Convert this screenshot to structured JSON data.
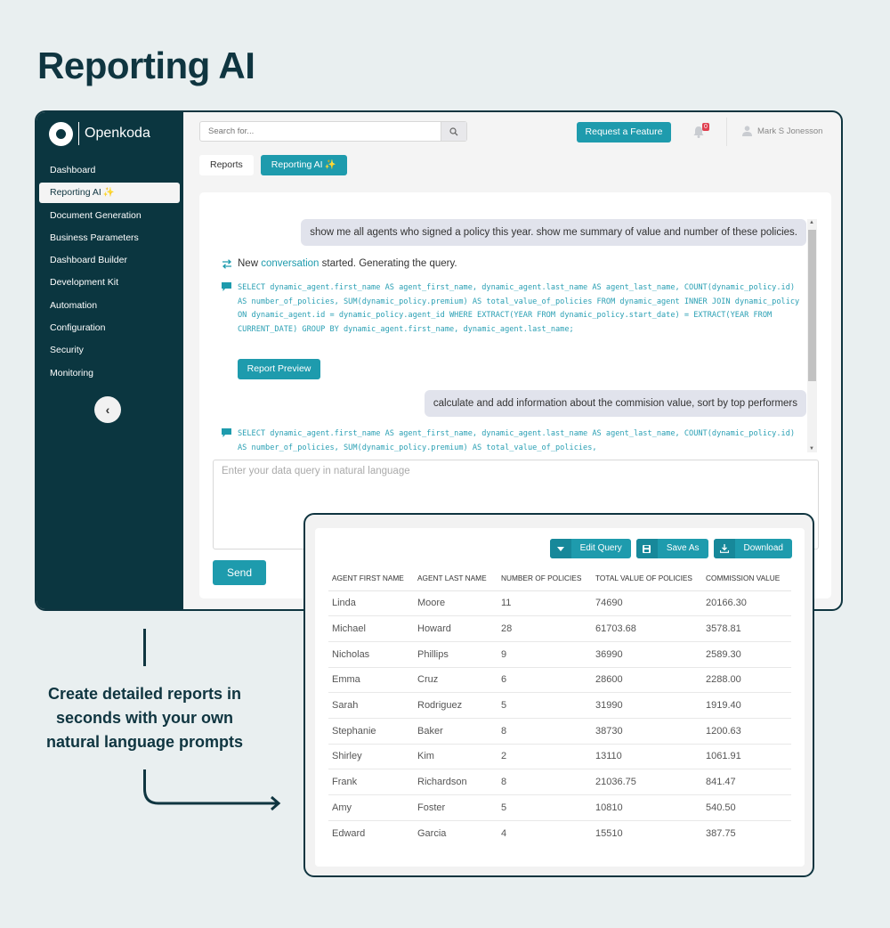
{
  "hero": {
    "title": "Reporting AI",
    "caption": "Create detailed reports in seconds with your own natural language prompts"
  },
  "app": {
    "brand": "Openkoda",
    "sidebar": {
      "items": [
        {
          "label": "Dashboard",
          "active": false
        },
        {
          "label": "Reporting AI",
          "active": true,
          "spark": "✨"
        },
        {
          "label": "Document Generation",
          "active": false
        },
        {
          "label": "Business Parameters",
          "active": false
        },
        {
          "label": "Dashboard Builder",
          "active": false
        },
        {
          "label": "Development Kit",
          "active": false
        },
        {
          "label": "Automation",
          "active": false
        },
        {
          "label": "Configuration",
          "active": false
        },
        {
          "label": "Security",
          "active": false
        },
        {
          "label": "Monitoring",
          "active": false
        }
      ],
      "collapse_icon": "‹"
    },
    "header": {
      "search_placeholder": "Search for...",
      "request_feature_label": "Request a Feature",
      "notifications_count": "0",
      "user_name": "Mark S Jonesson"
    },
    "tabs": [
      {
        "label": "Reports",
        "active": false
      },
      {
        "label": "Reporting AI",
        "active": true,
        "spark": "✨"
      }
    ],
    "chat": {
      "messages": [
        {
          "role": "user",
          "text": "show me all agents who signed a policy this year. show me summary of value and number of these policies."
        },
        {
          "role": "system",
          "prefix": "New",
          "link": "conversation",
          "suffix": "started. Generating the query."
        },
        {
          "role": "sql",
          "text": "SELECT dynamic_agent.first_name AS agent_first_name, dynamic_agent.last_name AS agent_last_name, COUNT(dynamic_policy.id) AS number_of_policies, SUM(dynamic_policy.premium) AS total_value_of_policies FROM dynamic_agent INNER JOIN dynamic_policy ON dynamic_agent.id = dynamic_policy.agent_id WHERE EXTRACT(YEAR FROM dynamic_policy.start_date) = EXTRACT(YEAR FROM CURRENT_DATE) GROUP BY dynamic_agent.first_name, dynamic_agent.last_name;"
        },
        {
          "role": "user",
          "text": "calculate and add information about the commision value, sort by top performers"
        },
        {
          "role": "sql",
          "text": "SELECT dynamic_agent.first_name AS agent_first_name, dynamic_agent.last_name AS agent_last_name, COUNT(dynamic_policy.id) AS number_of_policies, SUM(dynamic_policy.premium) AS total_value_of_policies,"
        }
      ],
      "report_preview_label": "Report Preview",
      "input_placeholder": "Enter your data query in natural language",
      "input_value": "",
      "send_label": "Send"
    }
  },
  "results": {
    "actions": [
      {
        "label": "Edit Query",
        "icon": "caret-down-icon"
      },
      {
        "label": "Save As",
        "icon": "floppy-disk-icon"
      },
      {
        "label": "Download",
        "icon": "download-icon"
      }
    ],
    "columns": [
      "AGENT FIRST NAME",
      "AGENT LAST NAME",
      "NUMBER OF POLICIES",
      "TOTAL VALUE OF POLICIES",
      "COMMISSION VALUE"
    ],
    "rows": [
      [
        "Linda",
        "Moore",
        "11",
        "74690",
        "20166.30"
      ],
      [
        "Michael",
        "Howard",
        "28",
        "61703.68",
        "3578.81"
      ],
      [
        "Nicholas",
        "Phillips",
        "9",
        "36990",
        "2589.30"
      ],
      [
        "Emma",
        "Cruz",
        "6",
        "28600",
        "2288.00"
      ],
      [
        "Sarah",
        "Rodriguez",
        "5",
        "31990",
        "1919.40"
      ],
      [
        "Stephanie",
        "Baker",
        "8",
        "38730",
        "1200.63"
      ],
      [
        "Shirley",
        "Kim",
        "2",
        "13110",
        "1061.91"
      ],
      [
        "Frank",
        "Richardson",
        "8",
        "21036.75",
        "841.47"
      ],
      [
        "Amy",
        "Foster",
        "5",
        "10810",
        "540.50"
      ],
      [
        "Edward",
        "Garcia",
        "4",
        "15510",
        "387.75"
      ]
    ]
  },
  "colors": {
    "brand_dark": "#0b3640",
    "accent": "#1e9bad",
    "background": "#e9eff0",
    "badge": "#e04050"
  }
}
